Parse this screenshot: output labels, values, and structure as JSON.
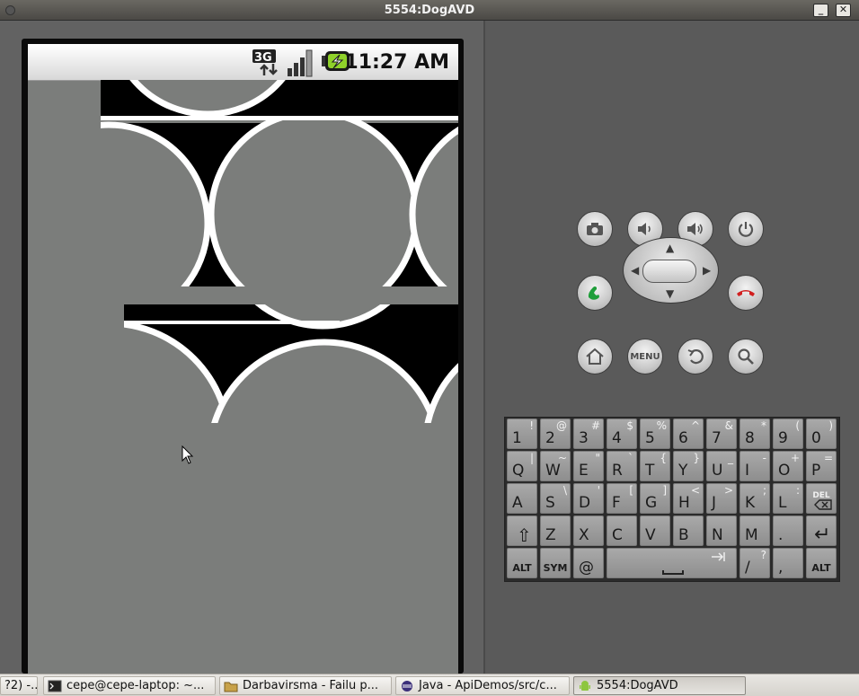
{
  "window": {
    "title": "5554:DogAVD",
    "minimize_label": "_",
    "close_label": "✕"
  },
  "device": {
    "status_time": "11:27 AM",
    "network_label": "3G",
    "icons": [
      "signal-3g-icon",
      "signal-strength-icon",
      "battery-charging-icon"
    ],
    "content": "tiled-circle-pattern"
  },
  "controls": {
    "row1": [
      "camera-icon",
      "volume-down-icon",
      "volume-up-icon",
      "power-icon"
    ],
    "row2": [
      "call-icon",
      "dpad",
      "end-call-icon"
    ],
    "row3": [
      "home-icon",
      "menu-button",
      "back-icon",
      "search-icon"
    ],
    "menu_label": "MENU"
  },
  "keyboard": {
    "rows": [
      [
        {
          "p": "1",
          "a": "!"
        },
        {
          "p": "2",
          "a": "@"
        },
        {
          "p": "3",
          "a": "#"
        },
        {
          "p": "4",
          "a": "$"
        },
        {
          "p": "5",
          "a": "%"
        },
        {
          "p": "6",
          "a": "^"
        },
        {
          "p": "7",
          "a": "&"
        },
        {
          "p": "8",
          "a": "*"
        },
        {
          "p": "9",
          "a": "("
        },
        {
          "p": "0",
          "a": ")"
        }
      ],
      [
        {
          "p": "Q",
          "a": "|"
        },
        {
          "p": "W",
          "a": "~"
        },
        {
          "p": "E",
          "a": "\""
        },
        {
          "p": "R",
          "a": "`"
        },
        {
          "p": "T",
          "a": "{"
        },
        {
          "p": "Y",
          "a": "}"
        },
        {
          "p": "U",
          "a": "_"
        },
        {
          "p": "I",
          "a": "-"
        },
        {
          "p": "O",
          "a": "+"
        },
        {
          "p": "P",
          "a": "="
        }
      ],
      [
        {
          "p": "A",
          "a": ""
        },
        {
          "p": "S",
          "a": "\\"
        },
        {
          "p": "D",
          "a": "'"
        },
        {
          "p": "F",
          "a": "["
        },
        {
          "p": "G",
          "a": "]"
        },
        {
          "p": "H",
          "a": "<"
        },
        {
          "p": "J",
          "a": ">"
        },
        {
          "p": "K",
          "a": ";"
        },
        {
          "p": "L",
          "a": ":"
        },
        {
          "p": "DEL",
          "a": ""
        }
      ],
      [
        {
          "p": "⇧",
          "a": ""
        },
        {
          "p": "Z",
          "a": ""
        },
        {
          "p": "X",
          "a": ""
        },
        {
          "p": "C",
          "a": ""
        },
        {
          "p": "V",
          "a": ""
        },
        {
          "p": "B",
          "a": ""
        },
        {
          "p": "N",
          "a": ""
        },
        {
          "p": "M",
          "a": ""
        },
        {
          "p": ".",
          "a": ""
        },
        {
          "p": "↵",
          "a": ""
        }
      ],
      [
        {
          "p": "ALT",
          "a": ""
        },
        {
          "p": "SYM",
          "a": ""
        },
        {
          "p": "@",
          "a": ""
        },
        {
          "p": "space",
          "a": ""
        },
        {
          "p": "/",
          "a": "?"
        },
        {
          "p": ",",
          "a": ""
        },
        {
          "p": "ALT",
          "a": ""
        }
      ]
    ]
  },
  "taskbar": {
    "items": [
      {
        "label": "?2) -...",
        "icon": "",
        "active": false
      },
      {
        "label": "cepe@cepe-laptop: ~...",
        "icon": "terminal-icon",
        "active": false
      },
      {
        "label": "Darbavirsma - Failu p...",
        "icon": "folder-icon",
        "active": false
      },
      {
        "label": "Java - ApiDemos/src/c...",
        "icon": "eclipse-icon",
        "active": false
      },
      {
        "label": "5554:DogAVD",
        "icon": "android-icon",
        "active": true
      }
    ]
  }
}
